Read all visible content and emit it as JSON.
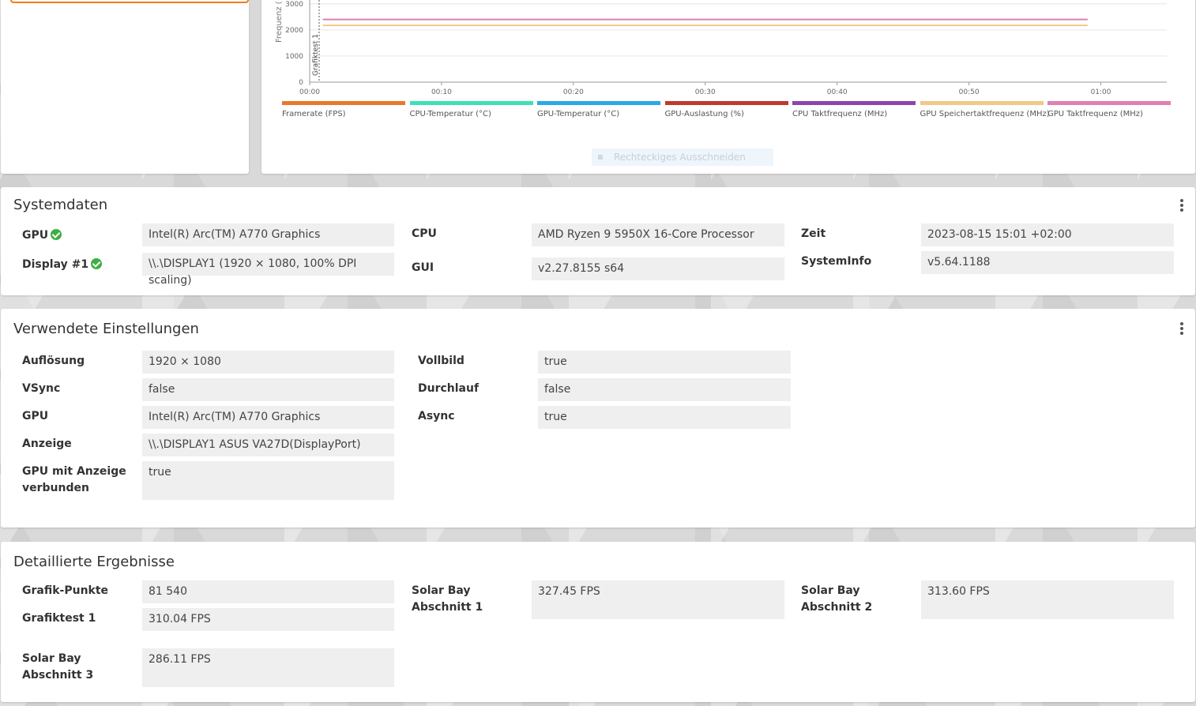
{
  "chart": {
    "yaxis_label": "Frequenz (",
    "marker_label": "Grafiktest 1",
    "crop_button": "Rechteckiges Ausschneiden",
    "chart_data": {
      "type": "line",
      "x": [
        "00:00",
        "00:10",
        "00:20",
        "00:30",
        "00:40",
        "00:50",
        "01:00"
      ],
      "yticks": [
        "3000",
        "2000",
        "1000",
        "0"
      ],
      "ylim": [
        0,
        3000
      ],
      "xlim_seconds": [
        0,
        65
      ],
      "series": [
        {
          "name": "GPU Taktfrequenz (MHz)",
          "color": "#e07fb0",
          "x": [
            1,
            59
          ],
          "values": [
            2400,
            2400
          ]
        },
        {
          "name": "GPU Speichertaktfrequenz (MHz)",
          "color": "#f0c987",
          "x": [
            1,
            59
          ],
          "values": [
            2175,
            2175
          ]
        }
      ],
      "legend": [
        {
          "name": "Framerate (FPS)",
          "color": "#e8792c"
        },
        {
          "name": "CPU-Temperatur (°C)",
          "color": "#3de0b6"
        },
        {
          "name": "GPU-Temperatur (°C)",
          "color": "#2ba8e8"
        },
        {
          "name": "GPU-Auslastung (%)",
          "color": "#c0392b"
        },
        {
          "name": "CPU Taktfrequenz (MHz)",
          "color": "#8e44ad"
        },
        {
          "name": "GPU Speichertaktfrequenz (MHz)",
          "color": "#f0c987"
        },
        {
          "name": "GPU Taktfrequenz (MHz)",
          "color": "#e07fb0"
        }
      ]
    }
  },
  "systemdaten": {
    "title": "Systemdaten",
    "gpu_label": "GPU",
    "gpu_value": "Intel(R) Arc(TM) A770 Graphics",
    "display_label": "Display #1",
    "display_value": "\\\\.\\DISPLAY1 (1920 × 1080, 100% DPI scaling)",
    "cpu_label": "CPU",
    "cpu_value": "AMD Ryzen 9 5950X 16-Core Processor",
    "gui_label": "GUI",
    "gui_value": "v2.27.8155 s64",
    "zeit_label": "Zeit",
    "zeit_value": "2023-08-15 15:01 +02:00",
    "sysinfo_label": "SystemInfo",
    "sysinfo_value": "v5.64.1188"
  },
  "einstellungen": {
    "title": "Verwendete Einstellungen",
    "aufloesung_label": "Auflösung",
    "aufloesung_value": "1920 × 1080",
    "vsync_label": "VSync",
    "vsync_value": "false",
    "gpu_label": "GPU",
    "gpu_value": "Intel(R) Arc(TM) A770 Graphics",
    "anzeige_label": "Anzeige",
    "anzeige_value": "\\\\.\\DISPLAY1 ASUS VA27D(DisplayPort)",
    "gpu_anzeige_label": "GPU mit Anzeige verbunden",
    "gpu_anzeige_value": "true",
    "vollbild_label": "Vollbild",
    "vollbild_value": "true",
    "durchlauf_label": "Durchlauf",
    "durchlauf_value": "false",
    "async_label": "Async",
    "async_value": "true"
  },
  "ergebnisse": {
    "title": "Detaillierte Ergebnisse",
    "grafik_punkte_label": "Grafik-Punkte",
    "grafik_punkte_value": "81 540",
    "grafiktest1_label": "Grafiktest 1",
    "grafiktest1_value": "310.04 FPS",
    "sb1_label": "Solar Bay Abschnitt 1",
    "sb1_value": "327.45 FPS",
    "sb2_label": "Solar Bay Abschnitt 2",
    "sb2_value": "313.60 FPS",
    "sb3_label": "Solar Bay Abschnitt 3",
    "sb3_value": "286.11 FPS"
  }
}
